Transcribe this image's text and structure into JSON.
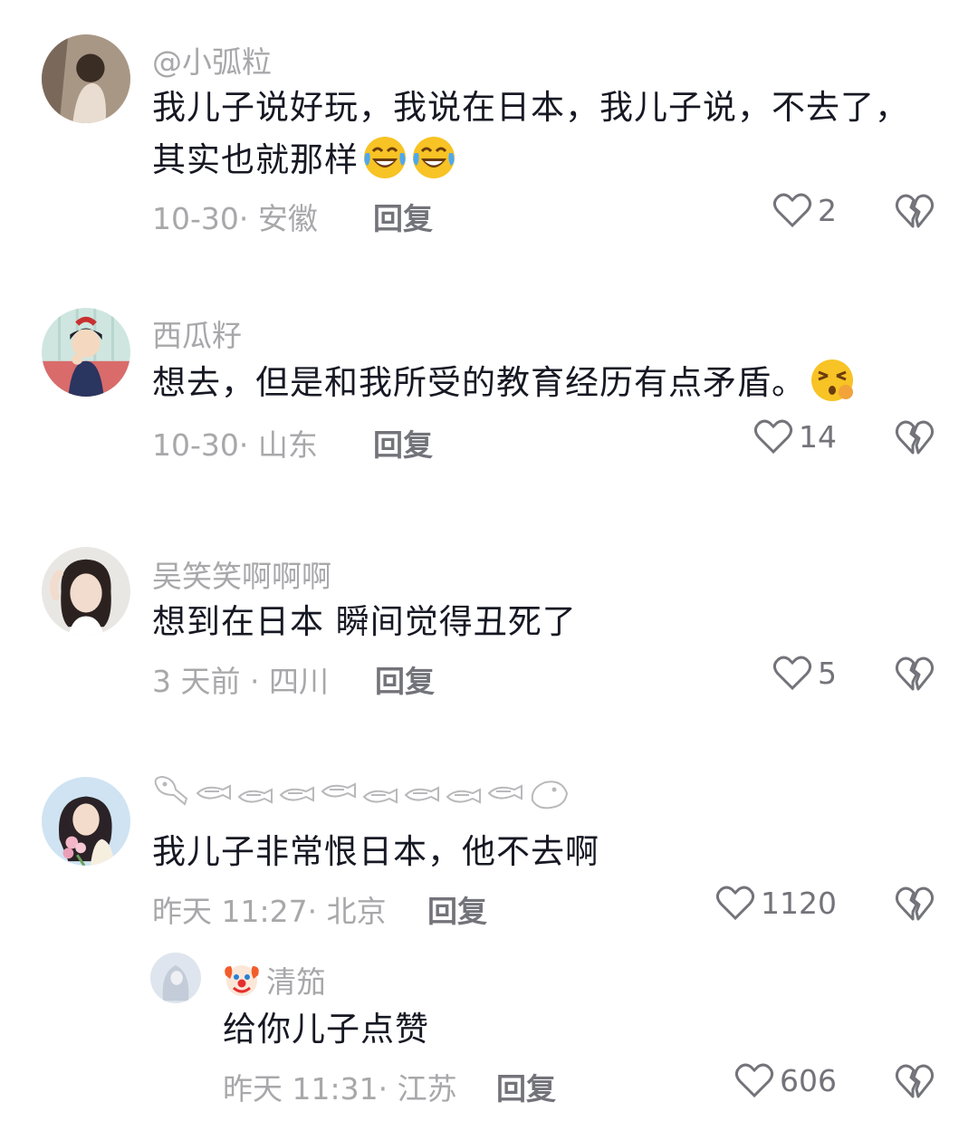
{
  "comments": [
    {
      "username": "@小弧粒",
      "text": "我儿子说好玩，我说在日本，我儿子说，不去了，其实也就那样",
      "text_emojis": [
        "laughing-crying-emoji",
        "laughing-crying-emoji"
      ],
      "meta": "10-30· 安徽",
      "reply_label": "回复",
      "likes": "2"
    },
    {
      "username": "西瓜籽",
      "text": "想去，但是和我所受的教育经历有点矛盾。",
      "text_emojis": [
        "confused-emoji"
      ],
      "meta": "10-30· 山东",
      "reply_label": "回复",
      "likes": "14"
    },
    {
      "username": "吴笑笑啊啊啊",
      "text": "想到在日本 瞬间觉得丑死了",
      "meta": "3 天前 · 四川",
      "reply_label": "回复",
      "likes": "5"
    },
    {
      "username_icons": "fish-doodle-row",
      "text": "我儿子非常恨日本，他不去啊",
      "meta": "昨天 11:27· 北京",
      "reply_label": "回复",
      "likes": "1120"
    }
  ],
  "sub_comment": {
    "badge_icon": "clown-emoji",
    "username": "清笳",
    "text": "给你儿子点赞",
    "meta": "昨天 11:31· 江苏",
    "reply_label": "回复",
    "likes": "606"
  },
  "colors": {
    "text": "#161823",
    "secondary": "#a8a8ab",
    "action": "#73737a",
    "background": "#ffffff"
  }
}
